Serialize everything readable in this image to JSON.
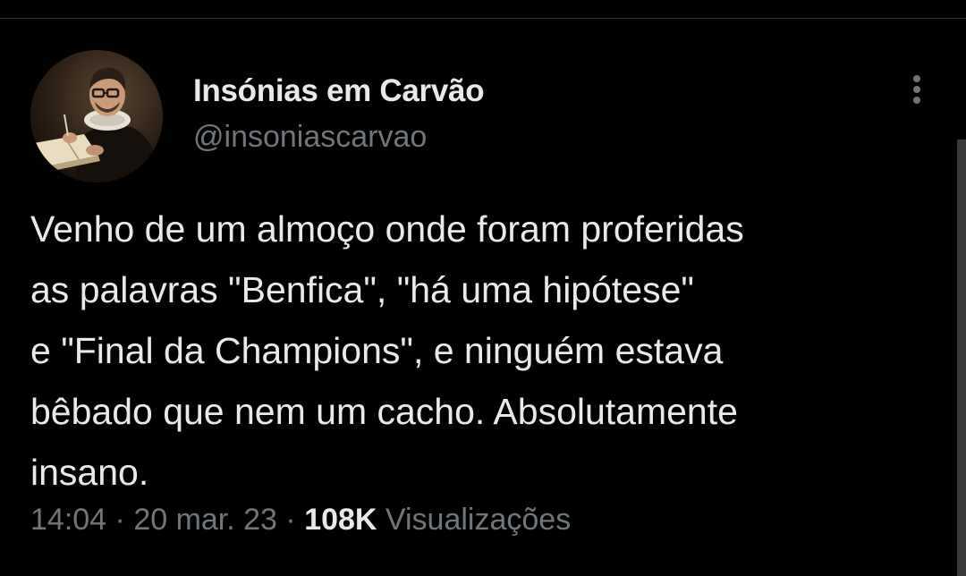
{
  "author": {
    "display_name": "Insónias em Carvão",
    "handle": "@insoniascarvao",
    "avatar_icon": "portrait-avatar-icon"
  },
  "actions": {
    "more_icon": "more-vertical-icon"
  },
  "tweet": {
    "lines": [
      "Venho de um almoço onde foram proferidas",
      "as palavras \"Benfica\", \"há uma hipótese\"",
      "e \"Final da Champions\", e ninguém estava",
      "bêbado que nem um cacho. Absolutamente",
      "insano."
    ]
  },
  "meta": {
    "time": "14:04",
    "separator": " · ",
    "date": "20 mar. 23",
    "views_count": "108K",
    "views_label": "Visualizações"
  },
  "colors": {
    "background": "#000000",
    "primary_text": "#e7e9ea",
    "secondary_text": "#71767b",
    "divider": "#2f3336"
  }
}
